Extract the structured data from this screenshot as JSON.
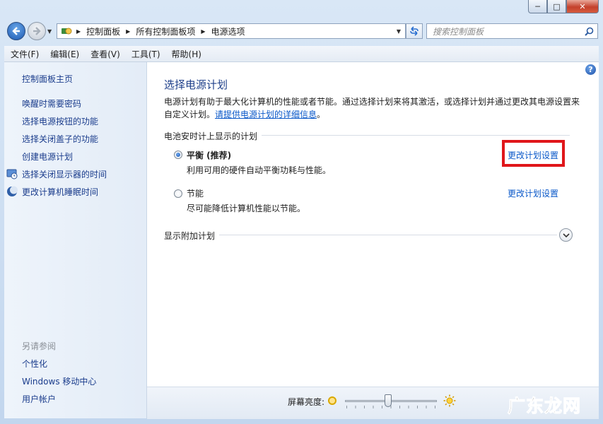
{
  "window": {
    "minimize_label": "─",
    "maximize_label": "□",
    "close_label": "✕"
  },
  "address_bar": {
    "crumbs": [
      "控制面板",
      "所有控制面板项",
      "电源选项"
    ]
  },
  "search": {
    "placeholder": "搜索控制面板"
  },
  "menu": {
    "items": [
      "文件(F)",
      "编辑(E)",
      "查看(V)",
      "工具(T)",
      "帮助(H)"
    ]
  },
  "sidebar": {
    "home": "控制面板主页",
    "links": [
      "唤醒时需要密码",
      "选择电源按钮的功能",
      "选择关闭盖子的功能",
      "创建电源计划",
      "选择关闭显示器的时间",
      "更改计算机睡眠时间"
    ],
    "see_also_heading": "另请参阅",
    "see_also": [
      "个性化",
      "Windows 移动中心",
      "用户帐户"
    ]
  },
  "main": {
    "title": "选择电源计划",
    "description": "电源计划有助于最大化计算机的性能或者节能。通过选择计划来将其激活，或选择计划并通过更改其电源设置来自定义计划。",
    "description_link": "请提供电源计划的详细信息",
    "description_end": "。",
    "group_label": "电池安时计上显示的计划",
    "plans": [
      {
        "name": "平衡 (推荐)",
        "desc": "利用可用的硬件自动平衡功耗与性能。",
        "link": "更改计划设置",
        "selected": true
      },
      {
        "name": "节能",
        "desc": "尽可能降低计算机性能以节能。",
        "link": "更改计划设置",
        "selected": false
      }
    ],
    "extra_plans_label": "显示附加计划"
  },
  "bottom": {
    "brightness_label": "屏幕亮度:",
    "brightness_level": 0.47
  },
  "watermark": "广东龙网",
  "colors": {
    "link": "#0a58c9",
    "highlight": "#e0161a",
    "title": "#1e3f8a"
  }
}
